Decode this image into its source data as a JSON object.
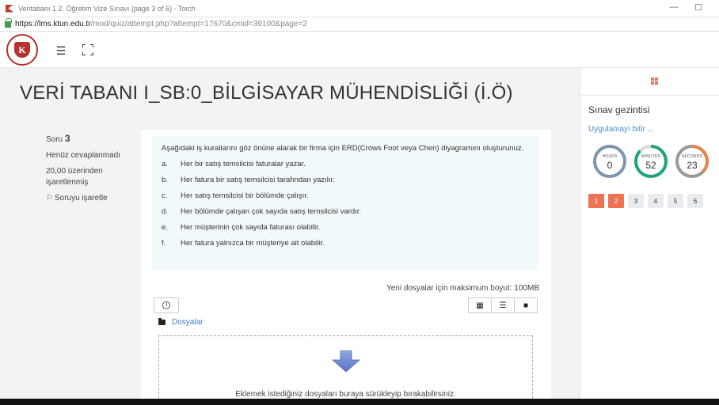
{
  "window": {
    "title": "Veritabanı 1 2. Öğretim Vize Sınavı (page 3 of 6) - Torch",
    "minimize_glyph": "—",
    "maximize_glyph": "☐"
  },
  "address": {
    "host": "https://lms.ktun.edu.tr",
    "path": "/mod/quiz/attempt.php?attempt=17670&cmid=39100&page=2"
  },
  "logo": {
    "letter": "K"
  },
  "navbar": {
    "menu_glyph": "☰"
  },
  "page": {
    "title": "VERİ TABANI I_SB:0_BİLGİSAYAR MÜHENDİSLİĞİ (İ.Ö)"
  },
  "question_info": {
    "soru_label": "Soru",
    "soru_number": "3",
    "status": "Henüz cevaplanmadı",
    "grade": "20,00 üzerinden işaretlenmiş",
    "flag_label": "Soruyu işaretle"
  },
  "question": {
    "intro": "Aşağıdaki iş kurallarını göz önüne alarak bir firma için ERD(Crows Foot veya Chen) diyagramını oluşturunuz.",
    "items": [
      {
        "letter": "a.",
        "text": "Her bir satış temsilcisi faturalar yazar."
      },
      {
        "letter": "b.",
        "text": "Her fatura bir satış temsilcisi tarafından yazılır."
      },
      {
        "letter": "c.",
        "text": "Her satış temsilcisi bir bölümde çalışır."
      },
      {
        "letter": "d.",
        "text": "Her bölümde çalışan çok sayıda satış temsilcisi vardır."
      },
      {
        "letter": "e.",
        "text": "Her müşterinin çok sayıda faturası olabilir."
      },
      {
        "letter": "f.",
        "text": "Her fatura yalnızca bir müşteriye ait olabilir."
      }
    ]
  },
  "filepicker": {
    "max_size": "Yeni dosyalar için maksimum boyut: 100MB",
    "folder_label": "Dosyalar",
    "drop_message": "Eklemek istediğiniz dosyaları buraya sürükleyip bırakabilirsiniz.",
    "view_icons_glyph": "▦",
    "view_list_glyph": "☰",
    "view_tree_glyph": "■"
  },
  "drawer": {
    "title": "Sınav gezintisi",
    "finish_link": "Uygulamayı bitir ...",
    "timers": [
      {
        "label": "HOURS",
        "value": "0",
        "color": "#7f95ad",
        "fraction": 0.0
      },
      {
        "label": "MINUTES",
        "value": "52",
        "color": "#1fa37a",
        "fraction": 0.87
      },
      {
        "label": "SECONDS",
        "value": "23",
        "color": "#e8844a",
        "fraction": 0.38
      }
    ],
    "questions": [
      {
        "num": "1",
        "answered": true
      },
      {
        "num": "2",
        "answered": true
      },
      {
        "num": "3",
        "answered": false
      },
      {
        "num": "4",
        "answered": false
      },
      {
        "num": "5",
        "answered": false
      },
      {
        "num": "6",
        "answered": false
      }
    ]
  }
}
